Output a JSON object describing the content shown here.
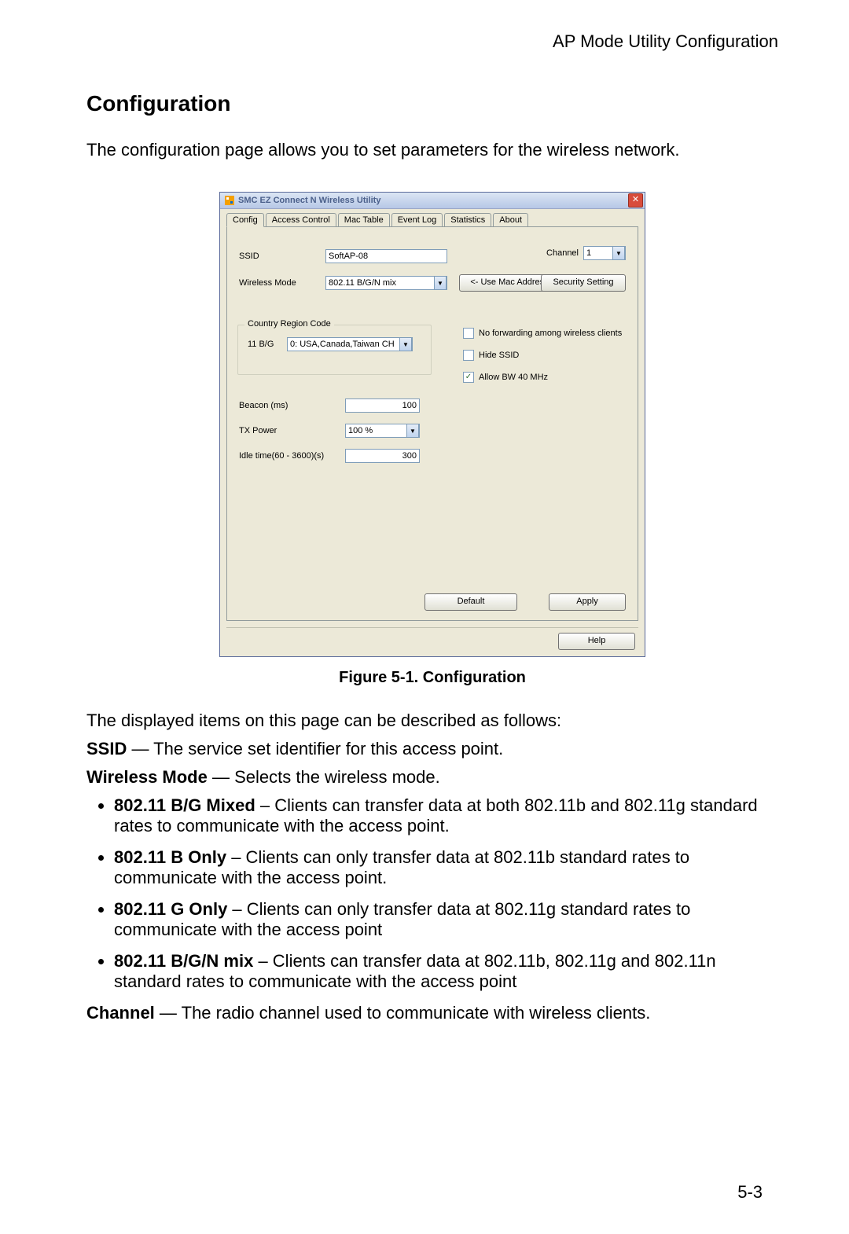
{
  "page_header": "AP Mode Utility Configuration",
  "section_title": "Configuration",
  "intro_text": "The configuration page allows you to set parameters for the wireless network.",
  "dialog": {
    "title": "SMC EZ Connect N Wireless Utility",
    "close_glyph": "✕",
    "tabs": [
      "Config",
      "Access Control",
      "Mac Table",
      "Event Log",
      "Statistics",
      "About"
    ],
    "ssid_label": "SSID",
    "ssid_value": "SoftAP-08",
    "channel_label": "Channel",
    "channel_value": "1",
    "wireless_mode_label": "Wireless Mode",
    "wireless_mode_value": "802.11 B/G/N mix",
    "use_mac_btn": "<- Use Mac Address",
    "security_btn": "Security Setting",
    "groupbox_legend": "Country Region Code",
    "region_label": "11 B/G",
    "region_value": "0: USA,Canada,Taiwan CH",
    "chk_noforward": "No forwarding among wireless clients",
    "chk_hidessid": "Hide SSID",
    "chk_allowbw": "Allow BW 40 MHz",
    "chk_noforward_checked": false,
    "chk_hidessid_checked": false,
    "chk_allowbw_checked": true,
    "beacon_label": "Beacon (ms)",
    "beacon_value": "100",
    "txpower_label": "TX Power",
    "txpower_value": "100 %",
    "idle_label": "Idle time(60 - 3600)(s)",
    "idle_value": "300",
    "default_btn": "Default",
    "apply_btn": "Apply",
    "help_btn": "Help"
  },
  "figure_caption": "Figure 5-1.  Configuration",
  "desc_intro": "The displayed items on this page can be described as follows:",
  "ssid_term": "SSID",
  "ssid_desc": " — The service set identifier for this access point.",
  "wm_term": "Wireless Mode",
  "wm_desc": " — Selects the wireless mode.",
  "bullets": [
    {
      "term": "802.11 B/G Mixed",
      "desc": " – Clients can transfer data at both 802.11b and 802.11g standard rates to communicate with the access point."
    },
    {
      "term": "802.11 B Only",
      "desc": " – Clients can only transfer data at 802.11b standard rates to communicate with the access point."
    },
    {
      "term": "802.11 G Only",
      "desc": " – Clients can only transfer data at 802.11g standard rates to communicate with the access point"
    },
    {
      "term": "802.11 B/G/N mix",
      "desc": " – Clients can transfer data at 802.11b, 802.11g and 802.11n standard rates to communicate with the access point"
    }
  ],
  "channel_term": "Channel",
  "channel_desc": " — The radio channel used to communicate with wireless clients.",
  "page_number": "5-3"
}
